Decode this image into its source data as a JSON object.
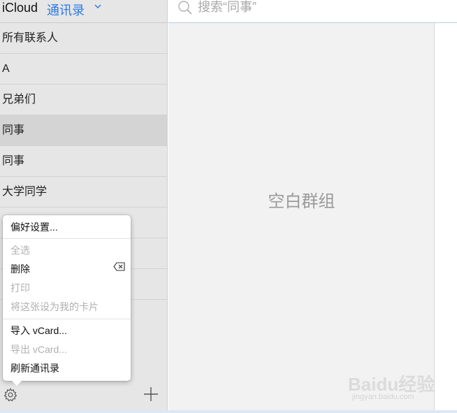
{
  "header": {
    "brand": "iCloud",
    "address_book": "通讯录"
  },
  "groups": [
    {
      "label": "所有联系人"
    },
    {
      "label": "A"
    },
    {
      "label": "兄弟们"
    },
    {
      "label": "同事",
      "selected": true
    },
    {
      "label": "同事"
    },
    {
      "label": "大学同学"
    }
  ],
  "search": {
    "placeholder": "搜索“同事”"
  },
  "empty_state": "空白群组",
  "menu": {
    "preferences": "偏好设置...",
    "select_all": "全选",
    "delete": "删除",
    "print": "打印",
    "make_my_card": "将这张设为我的卡片",
    "import_vcard": "导入 vCard...",
    "export_vcard": "导出 vCard...",
    "refresh": "刷新通讯录"
  },
  "watermark": {
    "brand": "Baidu经验",
    "site": "jingyan.baidu.com"
  },
  "colors": {
    "accent": "#2c7be5",
    "sidebar": "#e6e6e6",
    "selected_row": "#d4d4d4"
  }
}
